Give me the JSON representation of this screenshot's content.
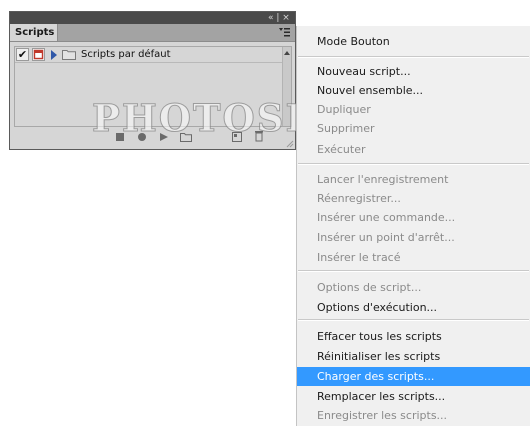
{
  "panel": {
    "topbar_controls": "« | ×",
    "tab_label": "Scripts",
    "rows": [
      {
        "checked": "✔",
        "label": "Scripts par défaut"
      }
    ]
  },
  "watermark": "PHOTOSHOPLUS",
  "menu": {
    "items": [
      {
        "label": "Mode Bouton",
        "state": "enabled"
      },
      {
        "label": "Nouveau script...",
        "state": "enabled"
      },
      {
        "label": "Nouvel ensemble...",
        "state": "enabled"
      },
      {
        "label": "Dupliquer",
        "state": "disabled"
      },
      {
        "label": "Supprimer",
        "state": "disabled"
      },
      {
        "label": "Exécuter",
        "state": "disabled"
      },
      {
        "label": "Lancer l'enregistrement",
        "state": "disabled"
      },
      {
        "label": "Réenregistrer...",
        "state": "disabled"
      },
      {
        "label": "Insérer une commande...",
        "state": "disabled"
      },
      {
        "label": "Insérer un point d'arrêt...",
        "state": "disabled"
      },
      {
        "label": "Insérer le tracé",
        "state": "disabled"
      },
      {
        "label": "Options de script...",
        "state": "disabled"
      },
      {
        "label": "Options d'exécution...",
        "state": "enabled"
      },
      {
        "label": "Effacer tous les scripts",
        "state": "enabled"
      },
      {
        "label": "Réinitialiser les scripts",
        "state": "enabled"
      },
      {
        "label": "Charger des scripts...",
        "state": "selected"
      },
      {
        "label": "Remplacer les scripts...",
        "state": "enabled"
      },
      {
        "label": "Enregistrer les scripts...",
        "state": "disabled"
      }
    ]
  },
  "colors": {
    "selection": "#3399ff",
    "disabled_text": "#8a8a8a",
    "panel_bg": "#d6d6d6"
  }
}
